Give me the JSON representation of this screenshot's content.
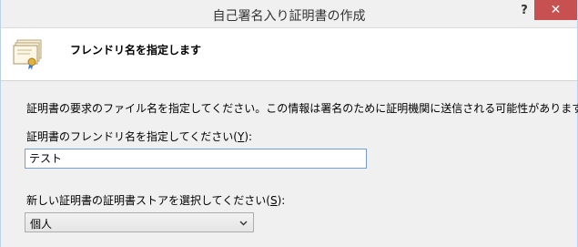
{
  "window": {
    "title": "自己署名入り証明書の作成",
    "help_label": "?",
    "close_label": "✕"
  },
  "header": {
    "title": "フレンドリ名を指定します",
    "icon": "certificate-icon"
  },
  "form": {
    "description": "証明書の要求のファイル名を指定してください。この情報は署名のために証明機関に送信される可能性があります:",
    "name_label_prefix": "証明書のフレンドリ名を指定してください(",
    "name_label_key": "Y",
    "name_label_suffix": "):",
    "name_value": "テスト",
    "store_label_prefix": "新しい証明書の証明書ストアを選択してください(",
    "store_label_key": "S",
    "store_label_suffix": "):",
    "store_value": "個人"
  },
  "colors": {
    "close_button": "#c75050",
    "input_border_focus": "#7a9cd3"
  }
}
